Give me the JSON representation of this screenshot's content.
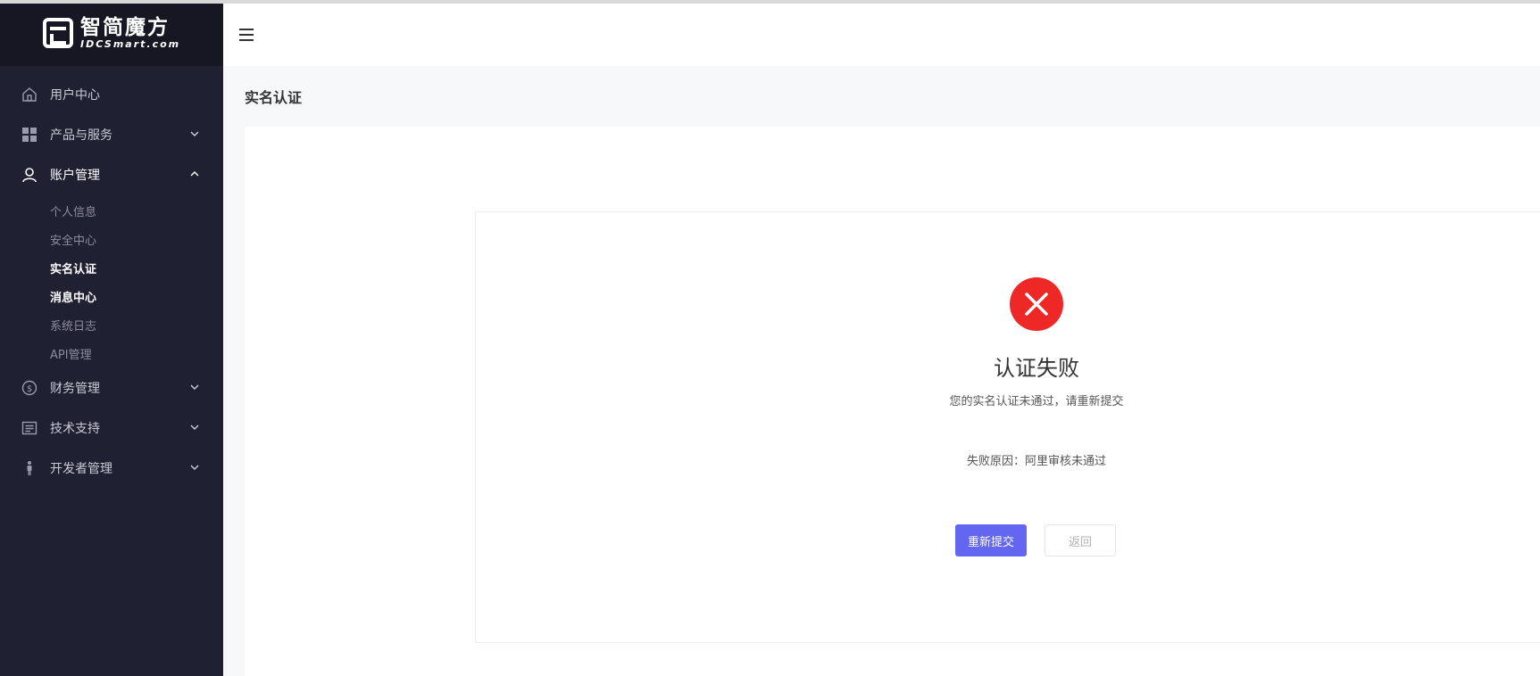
{
  "brand": {
    "name_cn": "智简魔方",
    "name_en": "IDCSmart.com"
  },
  "sidebar": {
    "items": [
      {
        "label": "用户中心",
        "icon": "home-icon"
      },
      {
        "label": "产品与服务",
        "icon": "grid-icon"
      },
      {
        "label": "账户管理",
        "icon": "user-icon",
        "children": [
          {
            "label": "个人信息"
          },
          {
            "label": "安全中心"
          },
          {
            "label": "实名认证",
            "active": true
          },
          {
            "label": "消息中心"
          },
          {
            "label": "系统日志"
          },
          {
            "label": "API管理"
          }
        ]
      },
      {
        "label": "财务管理",
        "icon": "dollar-icon"
      },
      {
        "label": "技术支持",
        "icon": "ticket-icon"
      },
      {
        "label": "开发者管理",
        "icon": "developer-icon"
      }
    ]
  },
  "page": {
    "title": "实名认证"
  },
  "result": {
    "status": "fail",
    "title": "认证失败",
    "description": "您的实名认证未通过，请重新提交",
    "reason": "失败原因：阿里审核未通过",
    "resubmit_label": "重新提交",
    "back_label": "返回"
  },
  "colors": {
    "sidebar_bg": "#1f2031",
    "accent": "#6366f1",
    "error": "#ee2727"
  }
}
